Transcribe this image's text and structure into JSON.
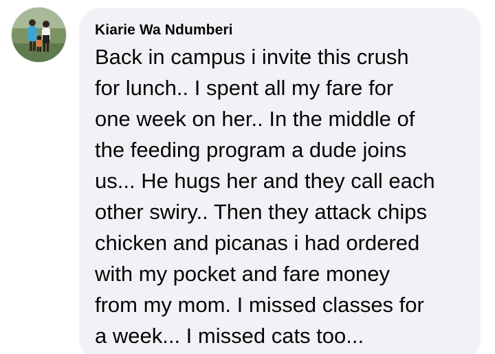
{
  "comment": {
    "author_name": "Kiarie Wa Ndumberi",
    "avatar_icon": "profile-photo-avatar",
    "bubble_color": "#f0f2f5",
    "text_lines": [
      "Back in campus i invite this crush",
      "for lunch.. I spent all my fare for",
      "one week on her.. In the middle of",
      "the feeding program a dude joins",
      "us... He hugs her and they call each",
      "other swiry.. Then they attack chips",
      "chicken and picanas i had ordered",
      "with my pocket and fare money",
      "from my mom. I missed classes for",
      "a week... I missed cats too..."
    ]
  }
}
